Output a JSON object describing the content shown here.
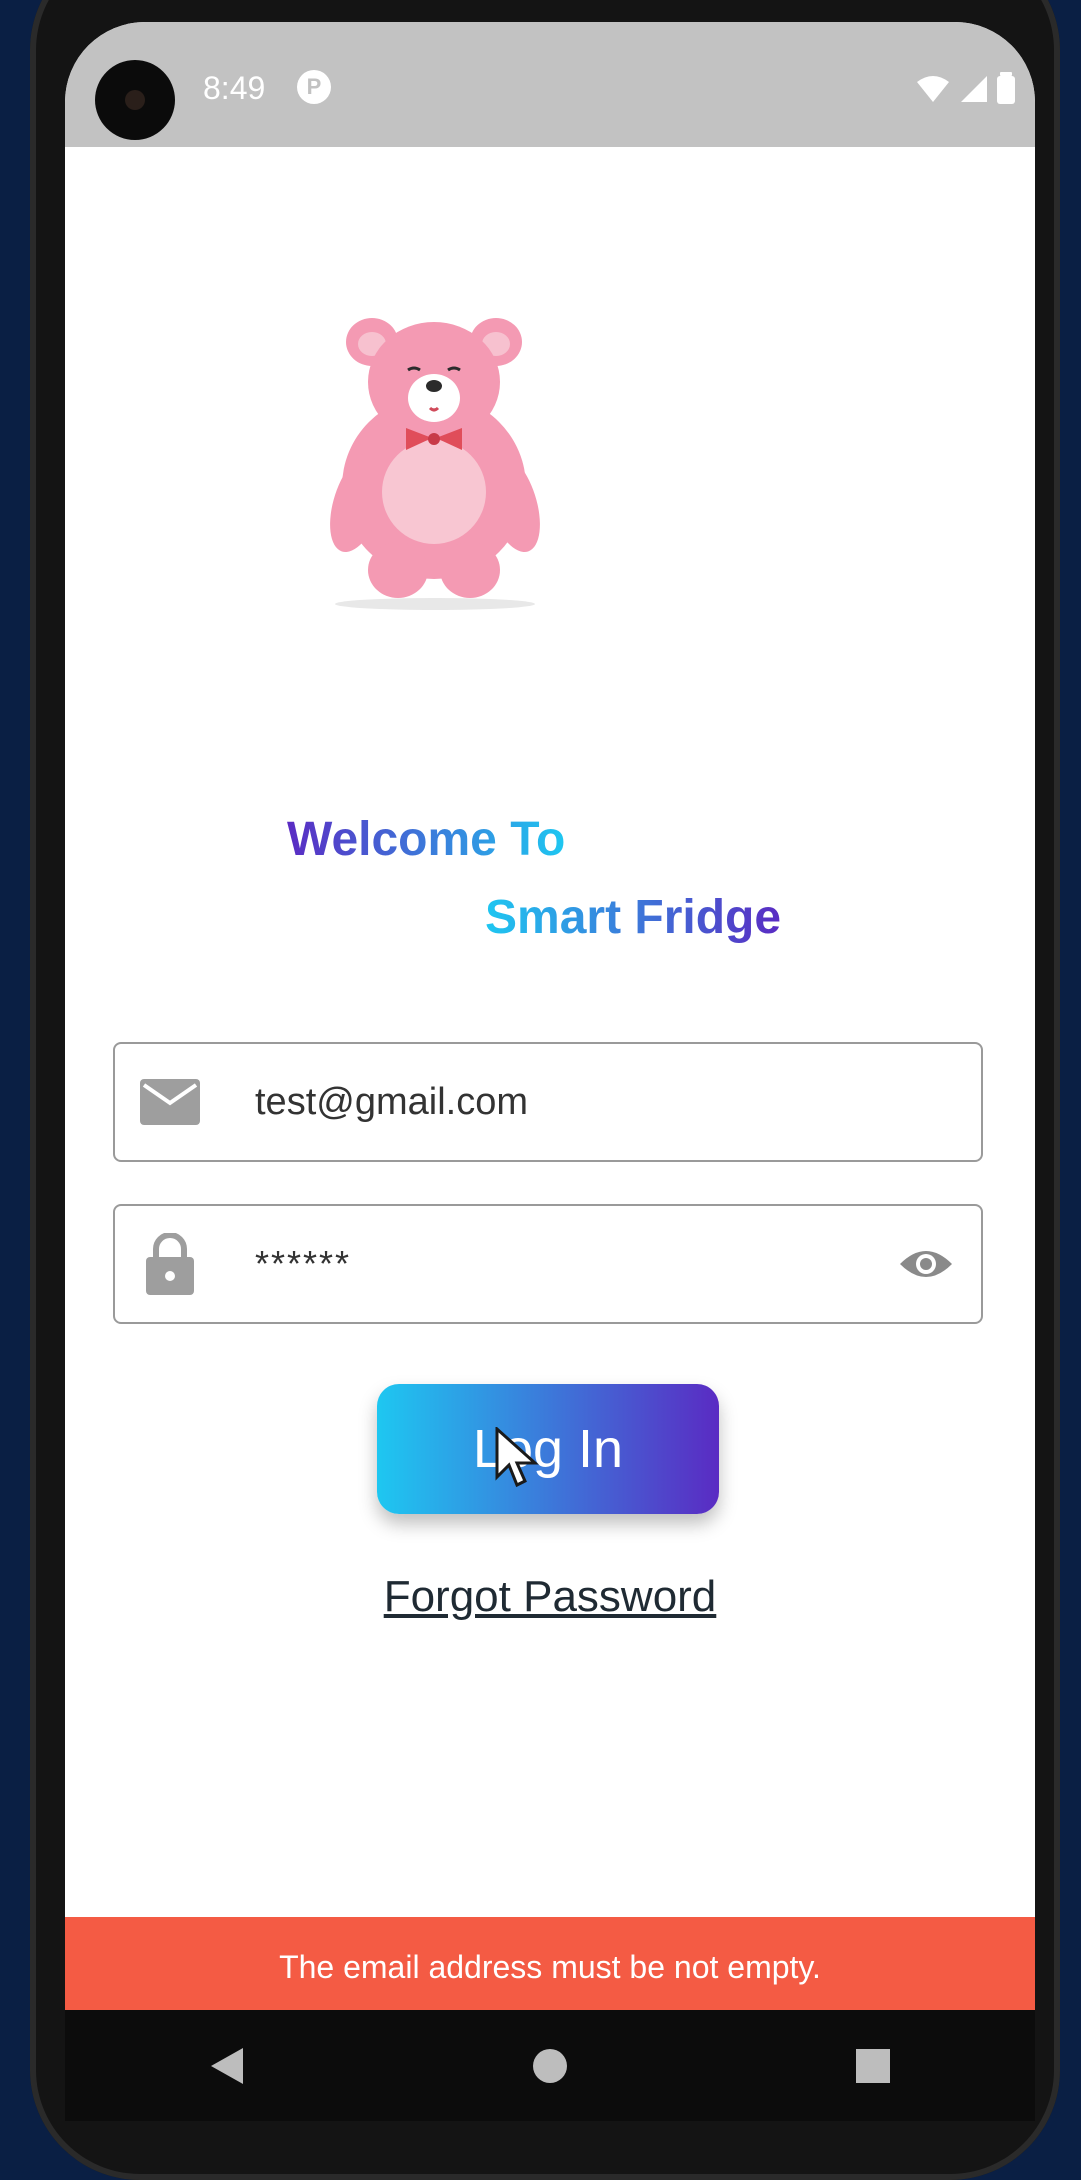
{
  "status_bar": {
    "time": "8:49",
    "notification_icon": "P"
  },
  "welcome": {
    "title": "Welcome To",
    "subtitle": "Smart Fridge"
  },
  "form": {
    "email_value": "test@gmail.com",
    "password_value": "******",
    "login_label": "Log In",
    "forgot_label": "Forgot Password"
  },
  "snackbar": {
    "message": "The email address must be not empty."
  },
  "colors": {
    "gradient_start": "#1ec7f1",
    "gradient_end": "#5a2bc3",
    "snackbar": "#f45b44",
    "status_bar": "#c2c2c2"
  },
  "icons": [
    "mail-icon",
    "lock-icon",
    "eye-icon",
    "wifi-icon",
    "signal-icon",
    "battery-icon",
    "back-icon",
    "home-icon",
    "recents-icon"
  ]
}
